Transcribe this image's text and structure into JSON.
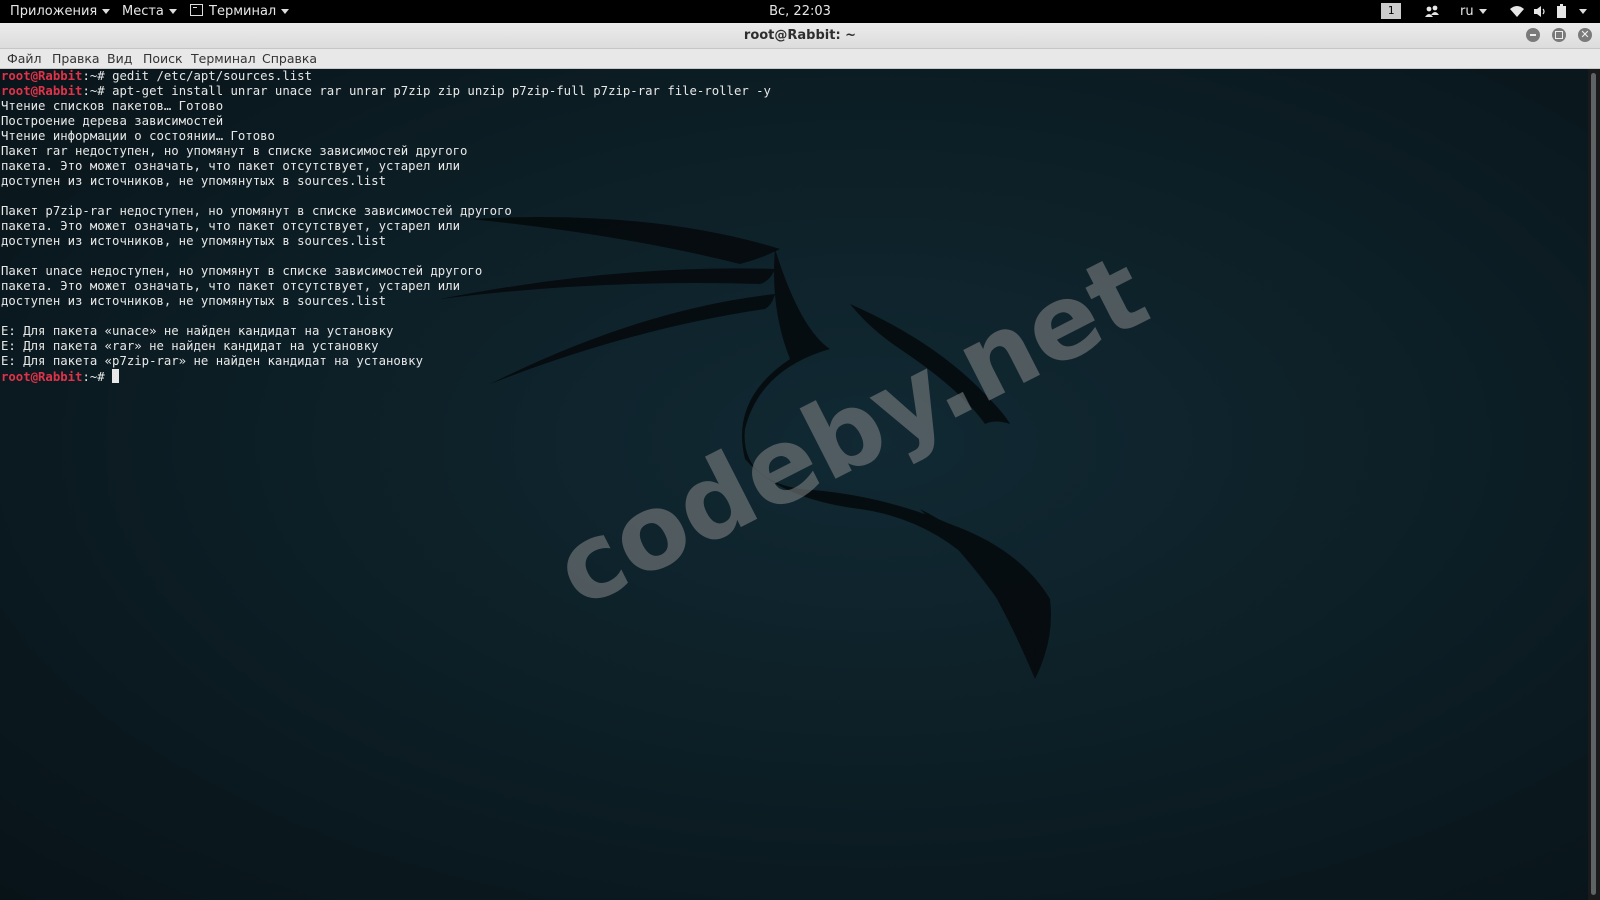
{
  "panel": {
    "applications_menu": "Приложения",
    "places_menu": "Места",
    "terminal_menu": "Терминал",
    "clock": "Вс, 22:03",
    "workspace_number": "1",
    "keyboard_layout": "ru"
  },
  "window": {
    "title": "root@Rabbit: ~"
  },
  "menubar": {
    "items": [
      "Файл",
      "Правка",
      "Вид",
      "Поиск",
      "Терминал",
      "Справка"
    ]
  },
  "terminal": {
    "prompt_user": "root@Rabbit",
    "prompt_suffix": ":~# ",
    "lines": [
      {
        "type": "prompt",
        "command": "gedit /etc/apt/sources.list"
      },
      {
        "type": "prompt",
        "command": "apt-get install unrar unace rar unrar p7zip zip unzip p7zip-full p7zip-rar file-roller -y"
      },
      {
        "type": "output",
        "text": "Чтение списков пакетов… Готово"
      },
      {
        "type": "output",
        "text": "Построение дерева зависимостей"
      },
      {
        "type": "output",
        "text": "Чтение информации о состоянии… Готово"
      },
      {
        "type": "output",
        "text": "Пакет rar недоступен, но упомянут в списке зависимостей другого"
      },
      {
        "type": "output",
        "text": "пакета. Это может означать, что пакет отсутствует, устарел или"
      },
      {
        "type": "output",
        "text": "доступен из источников, не упомянутых в sources.list"
      },
      {
        "type": "output",
        "text": ""
      },
      {
        "type": "output",
        "text": "Пакет p7zip-rar недоступен, но упомянут в списке зависимостей другого"
      },
      {
        "type": "output",
        "text": "пакета. Это может означать, что пакет отсутствует, устарел или"
      },
      {
        "type": "output",
        "text": "доступен из источников, не упомянутых в sources.list"
      },
      {
        "type": "output",
        "text": ""
      },
      {
        "type": "output",
        "text": "Пакет unace недоступен, но упомянут в списке зависимостей другого"
      },
      {
        "type": "output",
        "text": "пакета. Это может означать, что пакет отсутствует, устарел или"
      },
      {
        "type": "output",
        "text": "доступен из источников, не упомянутых в sources.list"
      },
      {
        "type": "output",
        "text": ""
      },
      {
        "type": "output",
        "text": "E: Для пакета «unace» не найден кандидат на установку"
      },
      {
        "type": "output",
        "text": "E: Для пакета «rar» не найден кандидат на установку"
      },
      {
        "type": "output",
        "text": "E: Для пакета «p7zip-rar» не найден кандидат на установку"
      },
      {
        "type": "prompt",
        "command": "",
        "cursor": true
      }
    ]
  },
  "watermark": {
    "text": "codeby.net"
  },
  "icons": {
    "caret": "chevron-down-icon",
    "terminal_app": "terminal-icon",
    "people": "people-icon",
    "wifi": "wifi-icon",
    "volume": "volume-icon",
    "battery": "battery-icon",
    "minimize": "minimize-icon",
    "maximize": "maximize-icon",
    "close": "close-icon"
  },
  "colors": {
    "prompt": "#e0334a",
    "terminal_bg": "#0d1a20",
    "text": "#e8e8e8"
  }
}
